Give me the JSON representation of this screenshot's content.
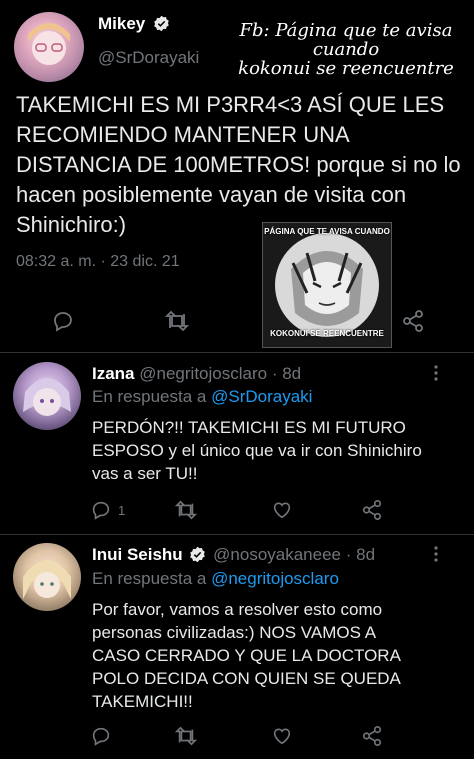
{
  "watermark": {
    "line1": "Fb: Página que te avisa cuando",
    "line2": "kokonui se reencuentre"
  },
  "main_tweet": {
    "display_name": "Mikey",
    "handle": "@SrDorayaki",
    "text": "TAKEMICHI ES MI P3RR4<3 ASÍ QUE LES RECOMIENDO MANTENER UNA DISTANCIA DE 100METROS! porque si no lo hacen posiblemente vayan de visita con Shinichiro:)",
    "timestamp": "08:32 a. m. · 23 dic. 21"
  },
  "reply1": {
    "display_name": "Izana",
    "handle": "@negritojosclaro",
    "age": "· 8d",
    "reply_prefix": "En respuesta a",
    "reply_to": "@SrDorayaki",
    "text": "PERDÓN?!! TAKEMICHI ES MI FUTURO ESPOSO y el único que va ir con Shinichiro vas a ser TU!!",
    "reply_count": "1"
  },
  "reply2": {
    "display_name": "Inui Seishu",
    "handle": "@nosoyakaneee",
    "age": "· 8d",
    "reply_prefix": "En respuesta a",
    "reply_to": "@negritojosclaro",
    "text": "Por favor, vamos a resolver esto como personas civilizadas:) NOS VAMOS A CASO CERRADO Y QUE LA DOCTORA POLO DECIDA CON QUIEN SE QUEDA TAKEMICHI!!"
  },
  "stamp": {
    "top": "PÁGINA QUE TE AVISA CUANDO",
    "bottom": "KOKONUI SE REENCUENTRE"
  },
  "colors": {
    "background": "#000000",
    "text": "#e7e9ea",
    "muted": "#71767b",
    "link": "#1d9bf0",
    "verified": "#1d9bf0"
  }
}
